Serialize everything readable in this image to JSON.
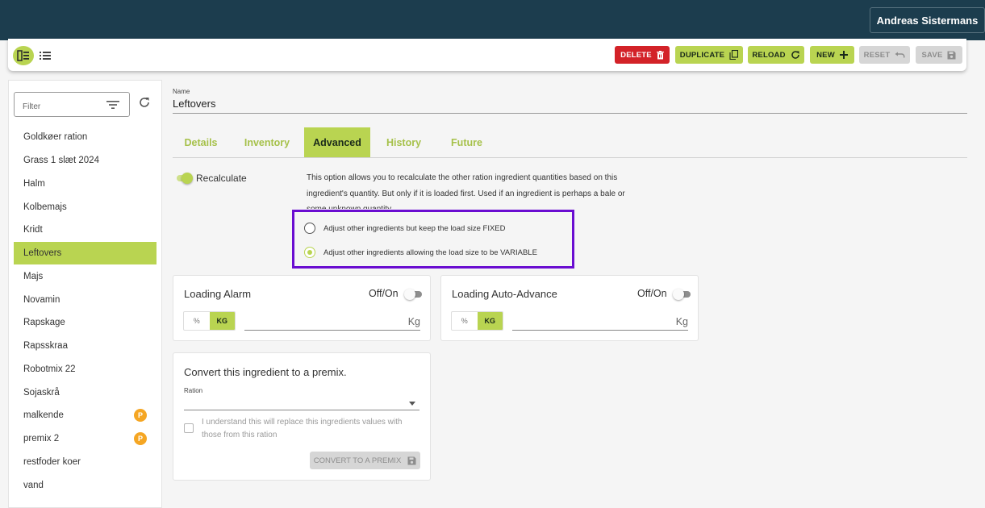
{
  "header": {
    "user_name": "Andreas Sistermans"
  },
  "toolbar": {
    "delete": "DELETE",
    "duplicate": "DUPLICATE",
    "reload": "RELOAD",
    "new": "NEW",
    "reset": "RESET",
    "save": "SAVE"
  },
  "sidebar": {
    "filter_placeholder": "Filter",
    "items": [
      {
        "label": "Goldkøer ration"
      },
      {
        "label": "Grass 1 slæt 2024"
      },
      {
        "label": "Halm"
      },
      {
        "label": "Kolbemajs"
      },
      {
        "label": "Kridt"
      },
      {
        "label": "Leftovers",
        "active": true
      },
      {
        "label": "Majs"
      },
      {
        "label": "Novamin"
      },
      {
        "label": "Rapskage"
      },
      {
        "label": "Rapsskraa"
      },
      {
        "label": "Robotmix 22"
      },
      {
        "label": "Sojaskrå"
      },
      {
        "label": "malkende",
        "badge": "P"
      },
      {
        "label": "premix 2",
        "badge": "P"
      },
      {
        "label": "restfoder koer"
      },
      {
        "label": "vand"
      }
    ]
  },
  "form": {
    "name_label": "Name",
    "name_value": "Leftovers"
  },
  "tabs": [
    {
      "label": "Details"
    },
    {
      "label": "Inventory"
    },
    {
      "label": "Advanced",
      "active": true
    },
    {
      "label": "History"
    },
    {
      "label": "Future"
    }
  ],
  "advanced": {
    "recalculate_label": "Recalculate",
    "recalculate_on": true,
    "description": "This option allows you to recalculate the other ration ingredient quantities based on this ingredient's quantity. But only if it is loaded first. Used if an ingredient is perhaps a bale or some unknown quantity.",
    "option_fixed": "Adjust other ingredients but keep the load size FIXED",
    "option_variable": "Adjust other ingredients allowing the load size to be VARIABLE",
    "selected_option": "variable"
  },
  "loading_alarm": {
    "title": "Loading Alarm",
    "offon_label": "Off/On",
    "unit_percent": "%",
    "unit_kg": "KG",
    "input_suffix": "Kg"
  },
  "loading_auto_advance": {
    "title": "Loading Auto-Advance",
    "offon_label": "Off/On",
    "unit_percent": "%",
    "unit_kg": "KG",
    "input_suffix": "Kg"
  },
  "premix": {
    "title": "Convert this ingredient to a premix.",
    "ration_label": "Ration",
    "checkbox_label": "I understand this will replace this ingredients values with those from this ration",
    "convert_button": "CONVERT TO A PREMIX"
  },
  "colors": {
    "accent": "#b9d451",
    "header": "#1c3d4e",
    "delete": "#d32228",
    "highlight": "#6a0dd1",
    "badge": "#f5a623"
  }
}
